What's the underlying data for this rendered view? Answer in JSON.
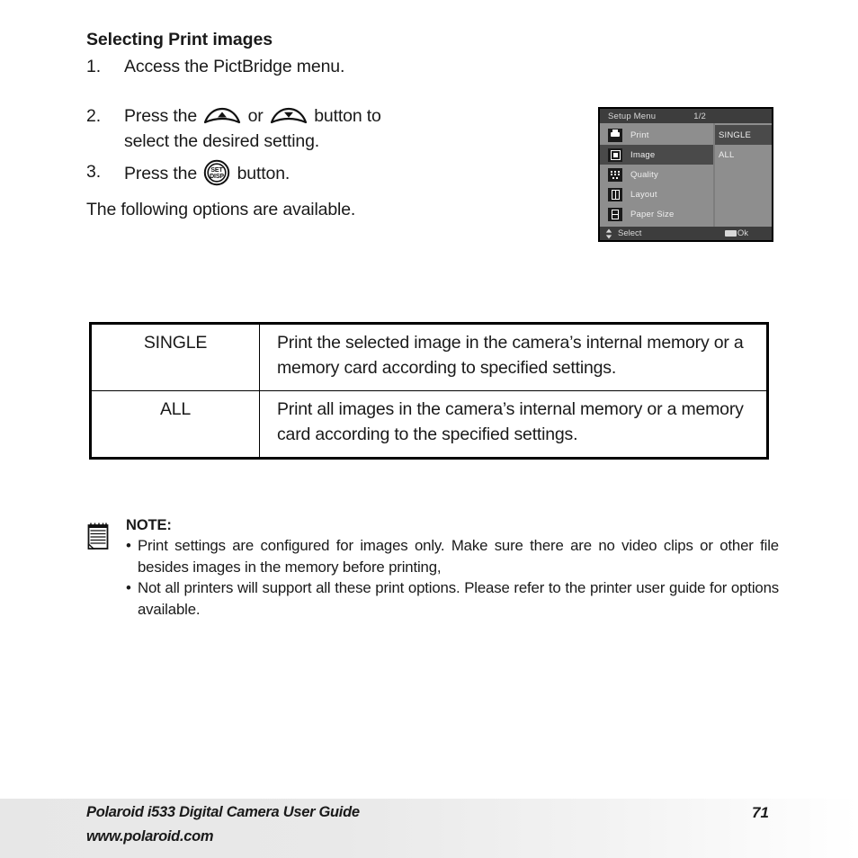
{
  "section": {
    "title": "Selecting Print images",
    "following_text": "The following options are available."
  },
  "steps": [
    {
      "num": "1.",
      "text_before": "Access the PictBridge menu.",
      "text_after": ""
    },
    {
      "num": "2.",
      "text_before": "Press the",
      "text_mid": "or",
      "text_after": "button to",
      "text_line2": "select the desired setting."
    },
    {
      "num": "3.",
      "text_before": "Press the",
      "text_after": "button."
    }
  ],
  "buttons": {
    "up_button_icon": "fan-up-button-icon",
    "down_button_icon": "fan-down-button-icon",
    "setdisp_top": "SET",
    "setdisp_bottom": "DISP"
  },
  "lcd": {
    "header_title": "Setup Menu",
    "page_indicator": "1/2",
    "menu_items": [
      {
        "label": "Print",
        "icon": "printer-icon",
        "selected": false
      },
      {
        "label": "Image",
        "icon": "image-frame-icon",
        "selected": true
      },
      {
        "label": "Quality",
        "icon": "quality-grid-icon",
        "selected": false
      },
      {
        "label": "Layout",
        "icon": "layout-icon",
        "selected": false
      },
      {
        "label": "Paper Size",
        "icon": "paper-size-icon",
        "selected": false
      }
    ],
    "values": [
      {
        "label": "SINGLE",
        "selected": true
      },
      {
        "label": "ALL",
        "selected": false
      }
    ],
    "footer_select": "Select",
    "footer_ok": "Ok"
  },
  "options_table": {
    "rows": [
      {
        "key": "SINGLE",
        "description": "Print the selected image in the camera’s internal memory or a memory card according to specified settings."
      },
      {
        "key": "ALL",
        "description": "Print all images in the camera’s internal memory or a memory card according to the specified settings."
      }
    ]
  },
  "note": {
    "icon": "notepad-icon",
    "title": "NOTE:",
    "items": [
      "Print settings are configured for images only. Make sure there are no video clips or other file besides images in the memory before printing,",
      "Not all printers will support all these print options. Please refer to the printer user guide for options available."
    ]
  },
  "footer": {
    "line1": "Polaroid i533 Digital Camera User Guide",
    "line2": "www.polaroid.com",
    "page_number": "71"
  },
  "colors": {
    "text": "#1a1a1a",
    "lcd_background": "#8e8e8e",
    "lcd_bar": "#3d3d3d",
    "lcd_highlight": "#4a4a4a",
    "footer_band": "#e7e7e7"
  }
}
